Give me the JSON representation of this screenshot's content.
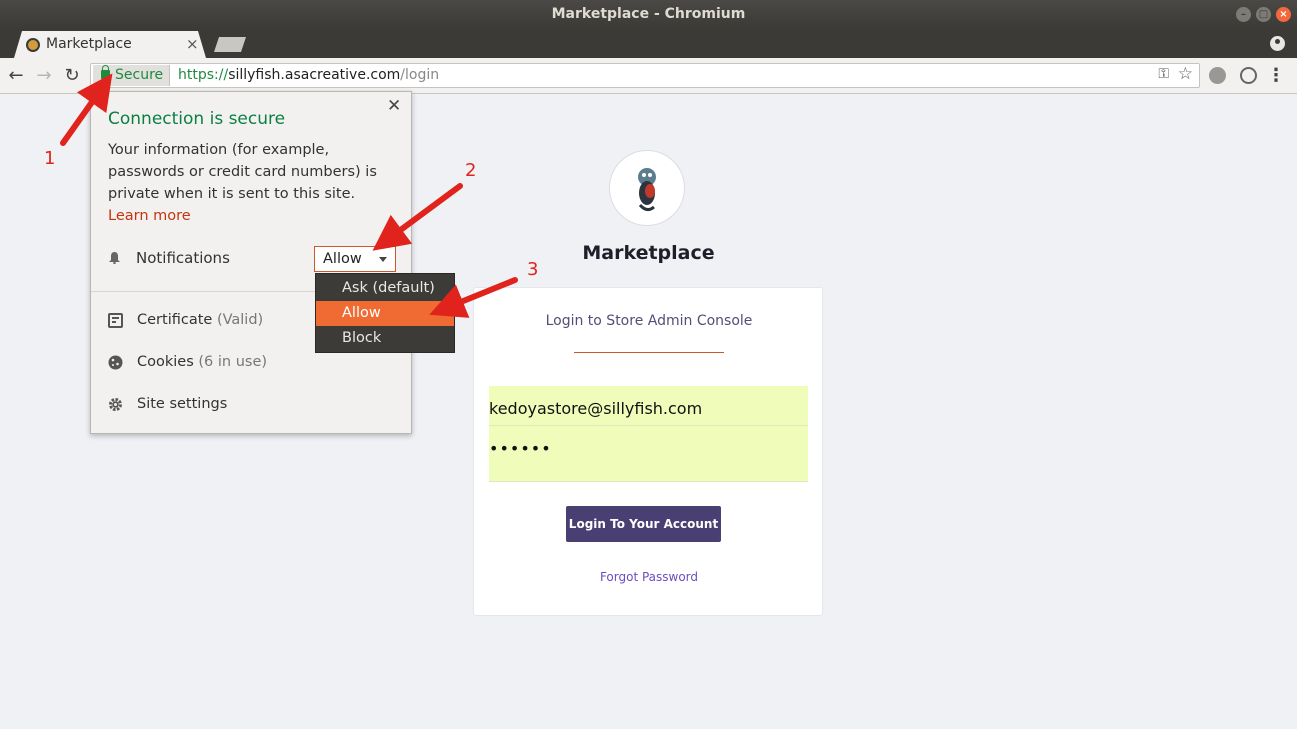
{
  "window": {
    "title": "Marketplace - Chromium"
  },
  "tab": {
    "title": "Marketplace",
    "close": "×"
  },
  "toolbar": {
    "back": "←",
    "forward": "→",
    "reload": "↻",
    "secure_label": "Secure",
    "url_scheme": "https://",
    "url_host": "sillyfish.asacreative.com",
    "url_path": "/login",
    "menu": "⋮"
  },
  "site_info": {
    "close": "✕",
    "title": "Connection is secure",
    "body_text": "Your information (for example, passwords or credit card numbers) is private when it is sent to this site.",
    "learn_more": "Learn more",
    "notifications_label": "Notifications",
    "notifications_value": "Allow",
    "certificate_label": "Certificate",
    "certificate_status": "(Valid)",
    "cookies_label": "Cookies",
    "cookies_status": "(6 in use)",
    "site_settings_label": "Site settings"
  },
  "dropdown": {
    "options": [
      "Ask (default)",
      "Allow",
      "Block"
    ],
    "selected": "Allow"
  },
  "page": {
    "brand": "Marketplace",
    "card_title": "Login to Store Admin Console",
    "email_value": "kedoyastore@sillyfish.com",
    "password_value": "••••••",
    "login_button": "Login To Your Account",
    "forgot_password": "Forgot Password"
  },
  "annotations": {
    "step1": "1",
    "step2": "2",
    "step3": "3",
    "arrow_color": "#e0231c"
  },
  "colors": {
    "secure_green": "#0b8043",
    "accent_orange": "#f06b34",
    "button_purple": "#493f72",
    "autofill_yellow": "#f0fcb9"
  }
}
